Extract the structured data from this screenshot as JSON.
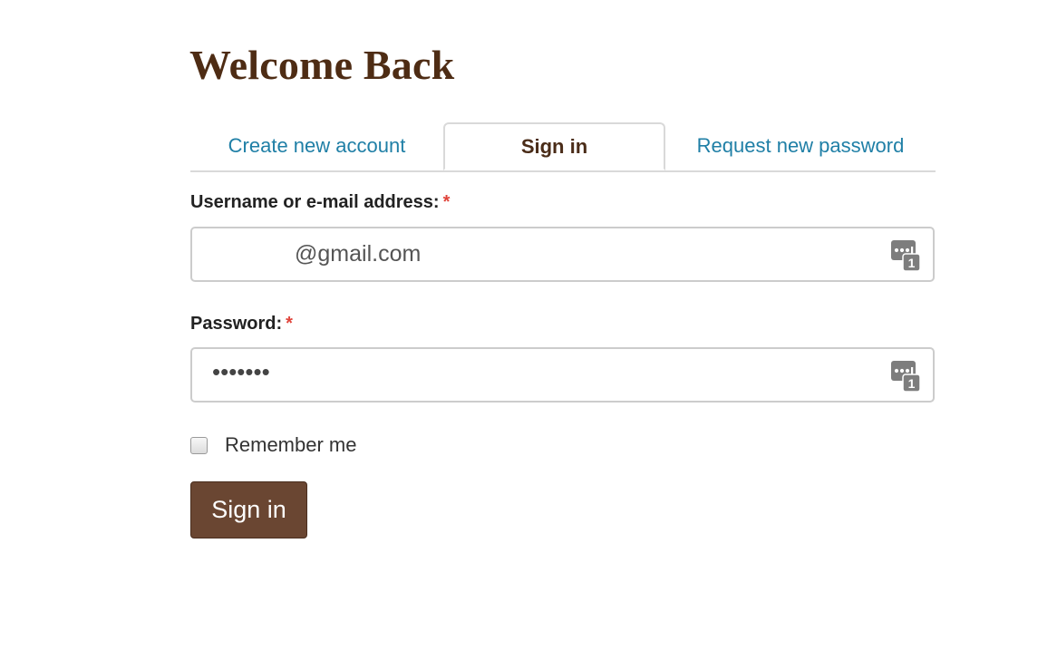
{
  "page": {
    "title": "Welcome Back"
  },
  "tabs": [
    {
      "label": "Create new account",
      "active": false
    },
    {
      "label": "Sign in",
      "active": true
    },
    {
      "label": "Request new password",
      "active": false
    }
  ],
  "form": {
    "username": {
      "label": "Username or e-mail address:",
      "required_marker": "*",
      "value": "@gmail.com",
      "icon": "password-manager-icon"
    },
    "password": {
      "label": "Password:",
      "required_marker": "*",
      "value": "•••••••",
      "icon": "password-manager-icon"
    },
    "remember": {
      "label": "Remember me",
      "checked": false
    },
    "submit_label": "Sign in"
  },
  "colors": {
    "heading": "#4e2c14",
    "link": "#1f7fa6",
    "required": "#e0443b",
    "button": "#6a4632"
  }
}
